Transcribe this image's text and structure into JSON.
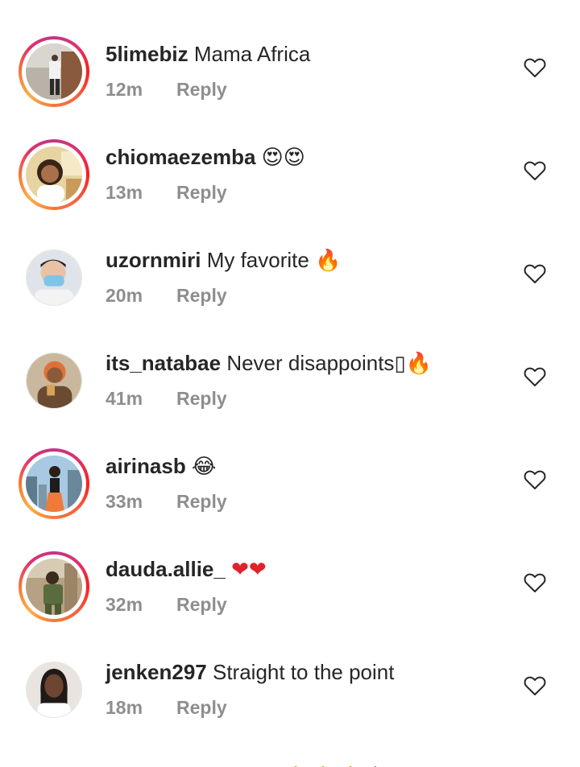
{
  "comments": [
    {
      "username": "5limebiz",
      "text": "Mama Africa",
      "emoji": "",
      "time": "12m",
      "reply_label": "Reply",
      "avatar_ring": true
    },
    {
      "username": "chiomaezemba",
      "text": "",
      "emoji": "😍😍",
      "time": "13m",
      "reply_label": "Reply",
      "avatar_ring": true
    },
    {
      "username": "uzornmiri",
      "text": "My favorite",
      "emoji": "🔥",
      "time": "20m",
      "reply_label": "Reply",
      "avatar_ring": false
    },
    {
      "username": "its_natabae",
      "text": "Never disappoints▯",
      "emoji": "🔥",
      "time": "41m",
      "reply_label": "Reply",
      "avatar_ring": false
    },
    {
      "username": "airinasb",
      "text": "",
      "emoji": "😂",
      "time": "33m",
      "reply_label": "Reply",
      "avatar_ring": true
    },
    {
      "username": "dauda.allie_",
      "text": "",
      "emoji": "❤❤",
      "time": "32m",
      "reply_label": "Reply",
      "avatar_ring": true
    },
    {
      "username": "jenken297",
      "text": "Straight to the point",
      "emoji": "",
      "time": "18m",
      "reply_label": "Reply",
      "avatar_ring": false
    }
  ],
  "icons": {
    "like": "heart-outline-icon"
  },
  "colors": {
    "username": "#262626",
    "meta": "#8e8e8e",
    "ring_start": "#c13584",
    "ring_end": "#fcaf45",
    "heart_stroke": "#262626"
  }
}
